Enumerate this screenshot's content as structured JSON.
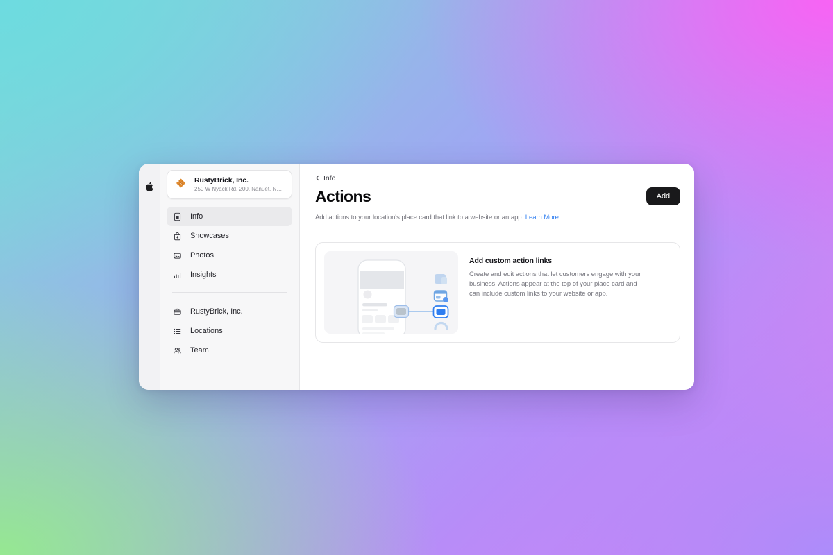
{
  "window": {
    "rail": {
      "logo_icon": "apple-logo"
    }
  },
  "sidebar": {
    "business": {
      "name": "RustyBrick, Inc.",
      "address": "250 W Nyack Rd, 200, Nanuet, NY 1...",
      "logo_icon": "rustybrick-lattice-logo",
      "logo_color": "#E08A2E"
    },
    "primary_items": [
      {
        "label": "Info",
        "icon": "id-card-icon",
        "active": true
      },
      {
        "label": "Showcases",
        "icon": "bag-plus-icon",
        "active": false
      },
      {
        "label": "Photos",
        "icon": "photo-icon",
        "active": false
      },
      {
        "label": "Insights",
        "icon": "bar-chart-icon",
        "active": false
      }
    ],
    "secondary_items": [
      {
        "label": "RustyBrick, Inc.",
        "icon": "briefcase-icon",
        "active": false
      },
      {
        "label": "Locations",
        "icon": "list-bullet-icon",
        "active": false
      },
      {
        "label": "Team",
        "icon": "people-icon",
        "active": false
      }
    ]
  },
  "main": {
    "back_label": "Info",
    "back_icon": "chevron-left-icon",
    "title": "Actions",
    "add_button_label": "Add",
    "subtitle_text": "Add actions to your location's place card that link to a website or an app.",
    "learn_more_label": "Learn More",
    "learn_more_color": "#2F7EF0",
    "promo": {
      "title": "Add custom action links",
      "description": "Create and edit actions that let customers engage with your business. Actions appear at the top of your place card and can include custom links to your website or app.",
      "illustration_icon": "place-card-actions-illustration"
    }
  }
}
